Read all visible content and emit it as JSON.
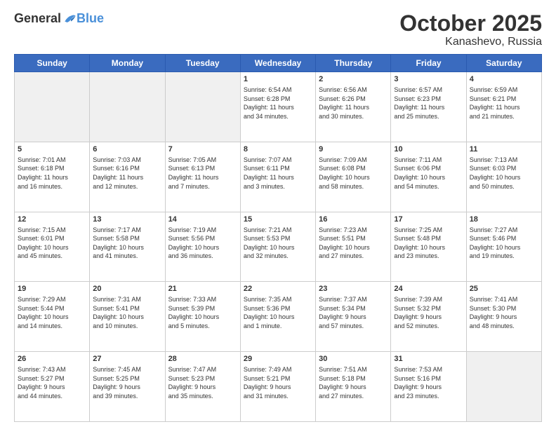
{
  "logo": {
    "general": "General",
    "blue": "Blue"
  },
  "title": "October 2025",
  "location": "Kanashevo, Russia",
  "days_of_week": [
    "Sunday",
    "Monday",
    "Tuesday",
    "Wednesday",
    "Thursday",
    "Friday",
    "Saturday"
  ],
  "weeks": [
    [
      {
        "day": "",
        "info": "",
        "empty": true
      },
      {
        "day": "",
        "info": "",
        "empty": true
      },
      {
        "day": "",
        "info": "",
        "empty": true
      },
      {
        "day": "1",
        "info": "Sunrise: 6:54 AM\nSunset: 6:28 PM\nDaylight: 11 hours\nand 34 minutes.",
        "empty": false
      },
      {
        "day": "2",
        "info": "Sunrise: 6:56 AM\nSunset: 6:26 PM\nDaylight: 11 hours\nand 30 minutes.",
        "empty": false
      },
      {
        "day": "3",
        "info": "Sunrise: 6:57 AM\nSunset: 6:23 PM\nDaylight: 11 hours\nand 25 minutes.",
        "empty": false
      },
      {
        "day": "4",
        "info": "Sunrise: 6:59 AM\nSunset: 6:21 PM\nDaylight: 11 hours\nand 21 minutes.",
        "empty": false
      }
    ],
    [
      {
        "day": "5",
        "info": "Sunrise: 7:01 AM\nSunset: 6:18 PM\nDaylight: 11 hours\nand 16 minutes.",
        "empty": false
      },
      {
        "day": "6",
        "info": "Sunrise: 7:03 AM\nSunset: 6:16 PM\nDaylight: 11 hours\nand 12 minutes.",
        "empty": false
      },
      {
        "day": "7",
        "info": "Sunrise: 7:05 AM\nSunset: 6:13 PM\nDaylight: 11 hours\nand 7 minutes.",
        "empty": false
      },
      {
        "day": "8",
        "info": "Sunrise: 7:07 AM\nSunset: 6:11 PM\nDaylight: 11 hours\nand 3 minutes.",
        "empty": false
      },
      {
        "day": "9",
        "info": "Sunrise: 7:09 AM\nSunset: 6:08 PM\nDaylight: 10 hours\nand 58 minutes.",
        "empty": false
      },
      {
        "day": "10",
        "info": "Sunrise: 7:11 AM\nSunset: 6:06 PM\nDaylight: 10 hours\nand 54 minutes.",
        "empty": false
      },
      {
        "day": "11",
        "info": "Sunrise: 7:13 AM\nSunset: 6:03 PM\nDaylight: 10 hours\nand 50 minutes.",
        "empty": false
      }
    ],
    [
      {
        "day": "12",
        "info": "Sunrise: 7:15 AM\nSunset: 6:01 PM\nDaylight: 10 hours\nand 45 minutes.",
        "empty": false
      },
      {
        "day": "13",
        "info": "Sunrise: 7:17 AM\nSunset: 5:58 PM\nDaylight: 10 hours\nand 41 minutes.",
        "empty": false
      },
      {
        "day": "14",
        "info": "Sunrise: 7:19 AM\nSunset: 5:56 PM\nDaylight: 10 hours\nand 36 minutes.",
        "empty": false
      },
      {
        "day": "15",
        "info": "Sunrise: 7:21 AM\nSunset: 5:53 PM\nDaylight: 10 hours\nand 32 minutes.",
        "empty": false
      },
      {
        "day": "16",
        "info": "Sunrise: 7:23 AM\nSunset: 5:51 PM\nDaylight: 10 hours\nand 27 minutes.",
        "empty": false
      },
      {
        "day": "17",
        "info": "Sunrise: 7:25 AM\nSunset: 5:48 PM\nDaylight: 10 hours\nand 23 minutes.",
        "empty": false
      },
      {
        "day": "18",
        "info": "Sunrise: 7:27 AM\nSunset: 5:46 PM\nDaylight: 10 hours\nand 19 minutes.",
        "empty": false
      }
    ],
    [
      {
        "day": "19",
        "info": "Sunrise: 7:29 AM\nSunset: 5:44 PM\nDaylight: 10 hours\nand 14 minutes.",
        "empty": false
      },
      {
        "day": "20",
        "info": "Sunrise: 7:31 AM\nSunset: 5:41 PM\nDaylight: 10 hours\nand 10 minutes.",
        "empty": false
      },
      {
        "day": "21",
        "info": "Sunrise: 7:33 AM\nSunset: 5:39 PM\nDaylight: 10 hours\nand 5 minutes.",
        "empty": false
      },
      {
        "day": "22",
        "info": "Sunrise: 7:35 AM\nSunset: 5:36 PM\nDaylight: 10 hours\nand 1 minute.",
        "empty": false
      },
      {
        "day": "23",
        "info": "Sunrise: 7:37 AM\nSunset: 5:34 PM\nDaylight: 9 hours\nand 57 minutes.",
        "empty": false
      },
      {
        "day": "24",
        "info": "Sunrise: 7:39 AM\nSunset: 5:32 PM\nDaylight: 9 hours\nand 52 minutes.",
        "empty": false
      },
      {
        "day": "25",
        "info": "Sunrise: 7:41 AM\nSunset: 5:30 PM\nDaylight: 9 hours\nand 48 minutes.",
        "empty": false
      }
    ],
    [
      {
        "day": "26",
        "info": "Sunrise: 7:43 AM\nSunset: 5:27 PM\nDaylight: 9 hours\nand 44 minutes.",
        "empty": false
      },
      {
        "day": "27",
        "info": "Sunrise: 7:45 AM\nSunset: 5:25 PM\nDaylight: 9 hours\nand 39 minutes.",
        "empty": false
      },
      {
        "day": "28",
        "info": "Sunrise: 7:47 AM\nSunset: 5:23 PM\nDaylight: 9 hours\nand 35 minutes.",
        "empty": false
      },
      {
        "day": "29",
        "info": "Sunrise: 7:49 AM\nSunset: 5:21 PM\nDaylight: 9 hours\nand 31 minutes.",
        "empty": false
      },
      {
        "day": "30",
        "info": "Sunrise: 7:51 AM\nSunset: 5:18 PM\nDaylight: 9 hours\nand 27 minutes.",
        "empty": false
      },
      {
        "day": "31",
        "info": "Sunrise: 7:53 AM\nSunset: 5:16 PM\nDaylight: 9 hours\nand 23 minutes.",
        "empty": false
      },
      {
        "day": "",
        "info": "",
        "empty": true
      }
    ]
  ]
}
